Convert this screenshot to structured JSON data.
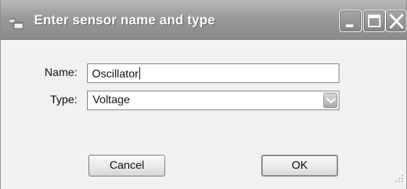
{
  "window": {
    "title": "Enter sensor name and type",
    "icon": "app-window-icon",
    "controls": {
      "minimize_icon": "minimize-icon",
      "maximize_icon": "maximize-icon",
      "close_icon": "close-icon"
    }
  },
  "form": {
    "name_label": "Name:",
    "name_value": "Oscillator",
    "type_label": "Type:",
    "type_value": "Voltage"
  },
  "buttons": {
    "cancel_label": "Cancel",
    "ok_label": "OK"
  },
  "colors": {
    "titlebar": "#9a9a9a",
    "dialog_bg": "#f1f1f1"
  }
}
